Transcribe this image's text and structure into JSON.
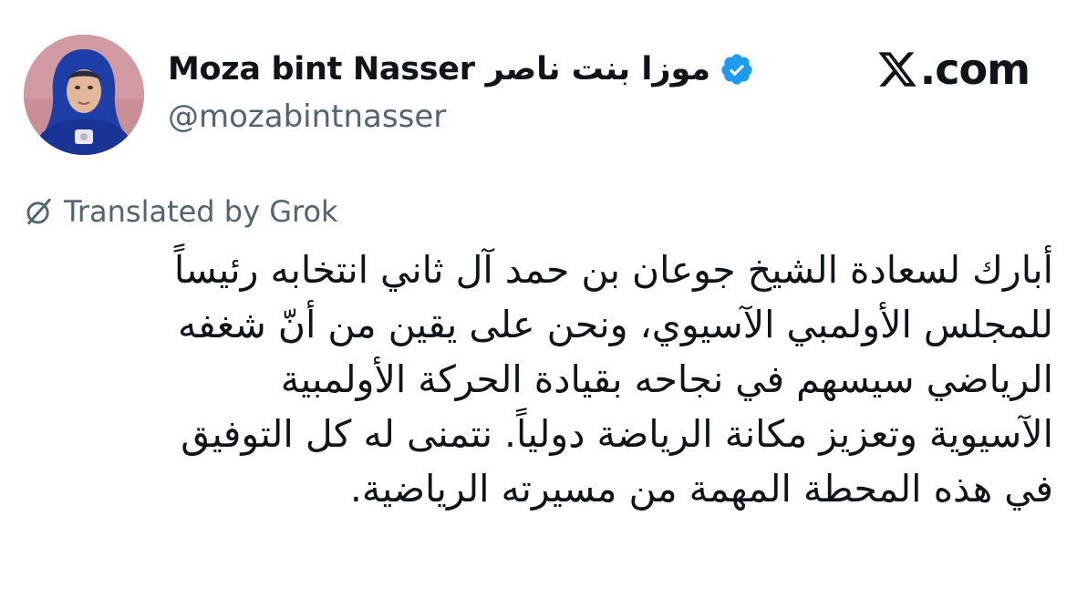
{
  "author": {
    "display_name": "Moza bint Nasser موزا بنت ناصر",
    "handle": "@mozabintnasser",
    "verified_icon": "verified-badge-icon",
    "verified_color": "#1d9bf0"
  },
  "site": {
    "label": ".com",
    "logo_icon": "x-logo-icon"
  },
  "translation": {
    "label": "Translated by Grok",
    "icon": "translate-icon"
  },
  "tweet": {
    "lines": [
      "أبارك لسعادة الشيخ جوعان بن حمد آل ثاني انتخابه رئيساً",
      "للمجلس الأولمبي الآسيوي، ونحن على يقين من أنّ شغفه",
      "الرياضي سيسهم في نجاحه بقيادة الحركة الأولمبية",
      "الآسيوية وتعزيز مكانة الرياضة دولياً. نتمنى له كل التوفيق",
      "في هذه المحطة المهمة من مسيرته الرياضية."
    ]
  },
  "colors": {
    "text_primary": "#0f1419",
    "text_secondary": "#536471",
    "accent": "#1d9bf0"
  }
}
